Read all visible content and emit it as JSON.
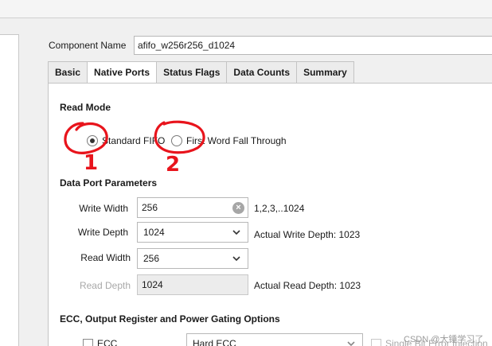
{
  "component": {
    "label": "Component Name",
    "value": "afifo_w256r256_d1024"
  },
  "tabs": [
    {
      "label": "Basic",
      "active": false
    },
    {
      "label": "Native Ports",
      "active": true
    },
    {
      "label": "Status Flags",
      "active": false
    },
    {
      "label": "Data Counts",
      "active": false
    },
    {
      "label": "Summary",
      "active": false
    }
  ],
  "read_mode": {
    "title": "Read Mode",
    "options": [
      {
        "label": "Standard FIFO",
        "selected": true
      },
      {
        "label": "First Word Fall Through",
        "selected": false
      }
    ]
  },
  "data_port": {
    "title": "Data Port Parameters",
    "write_width": {
      "label": "Write Width",
      "value": "256",
      "hint": "1,2,3,..1024"
    },
    "write_depth": {
      "label": "Write Depth",
      "value": "1024",
      "hint": "Actual Write Depth: 1023"
    },
    "read_width": {
      "label": "Read Width",
      "value": "256"
    },
    "read_depth": {
      "label": "Read Depth",
      "value": "1024",
      "hint": "Actual Read Depth: 1023"
    }
  },
  "ecc_section": {
    "title": "ECC, Output Register and Power Gating Options",
    "ecc_label": "ECC",
    "ecc_mode": "Hard ECC",
    "sbit_label": "Single Bit Error Injection"
  },
  "annotations": {
    "mark_1": "1",
    "mark_2": "2"
  },
  "watermark": "CSDN @大锤学习了",
  "colors": {
    "annotation": "#e8141c",
    "active_tab": "#ffffff",
    "inactive_tab": "#ececec"
  }
}
